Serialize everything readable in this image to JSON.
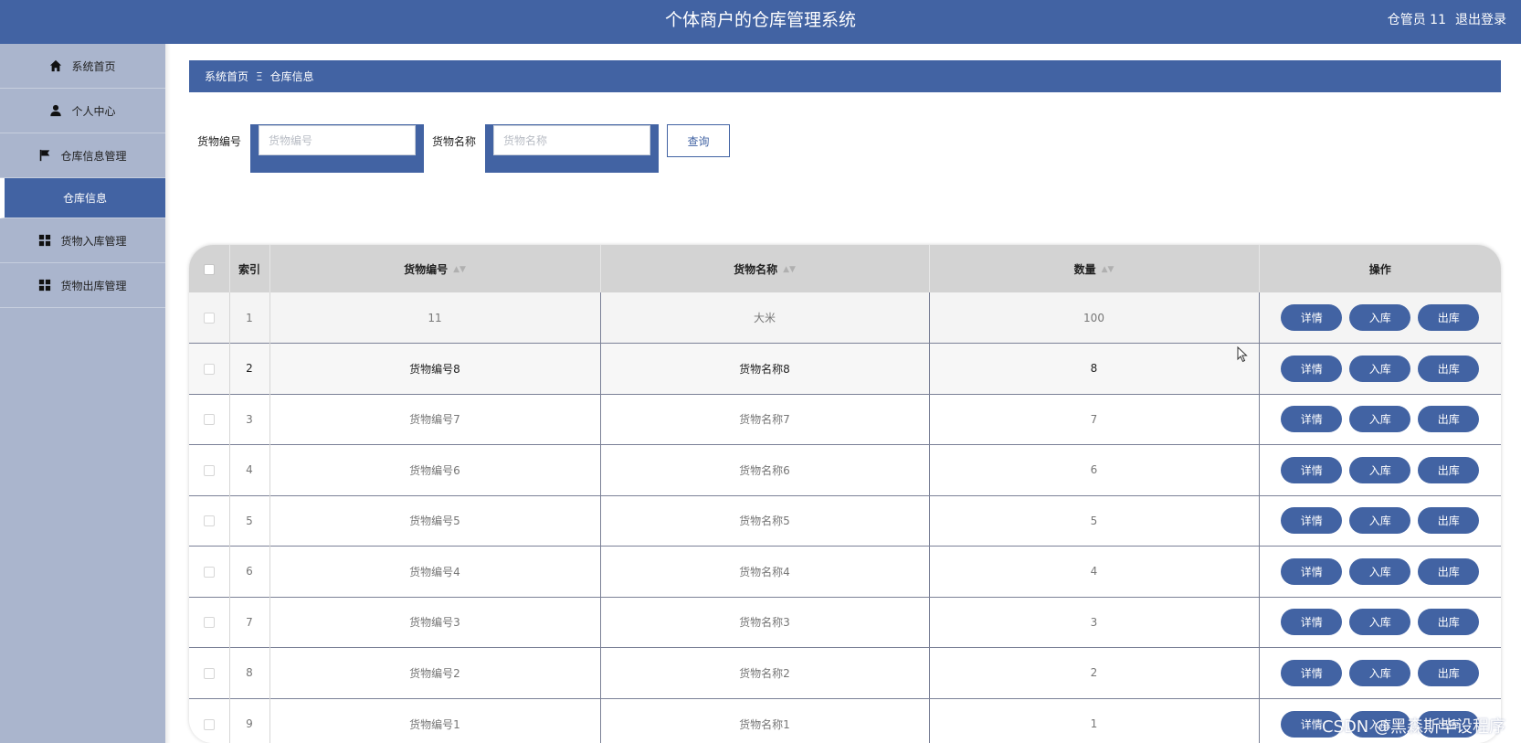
{
  "header": {
    "title": "个体商户的仓库管理系统",
    "user": "仓管员 11",
    "logout": "退出登录"
  },
  "sidebar": {
    "items": [
      {
        "label": "系统首页",
        "icon": "home-icon"
      },
      {
        "label": "个人中心",
        "icon": "user-icon"
      },
      {
        "label": "仓库信息管理",
        "icon": "flag-icon"
      },
      {
        "label": "仓库信息",
        "icon": "",
        "active": true
      },
      {
        "label": "货物入库管理",
        "icon": "grid-icon"
      },
      {
        "label": "货物出库管理",
        "icon": "grid-icon"
      }
    ]
  },
  "breadcrumb": {
    "home": "系统首页",
    "separator": "Ξ",
    "current": "仓库信息"
  },
  "search": {
    "code_label": "货物编号",
    "code_placeholder": "货物编号",
    "code_value": "",
    "name_label": "货物名称",
    "name_placeholder": "货物名称",
    "name_value": "",
    "query_button": "查询"
  },
  "table": {
    "columns": [
      "",
      "索引",
      "货物编号",
      "货物名称",
      "数量",
      "操作"
    ],
    "actions": [
      "详情",
      "入库",
      "出库"
    ],
    "rows": [
      {
        "index": "1",
        "code": "11",
        "name": "大米",
        "qty": "100"
      },
      {
        "index": "2",
        "code": "货物编号8",
        "name": "货物名称8",
        "qty": "8"
      },
      {
        "index": "3",
        "code": "货物编号7",
        "name": "货物名称7",
        "qty": "7"
      },
      {
        "index": "4",
        "code": "货物编号6",
        "name": "货物名称6",
        "qty": "6"
      },
      {
        "index": "5",
        "code": "货物编号5",
        "name": "货物名称5",
        "qty": "5"
      },
      {
        "index": "6",
        "code": "货物编号4",
        "name": "货物名称4",
        "qty": "4"
      },
      {
        "index": "7",
        "code": "货物编号3",
        "name": "货物名称3",
        "qty": "3"
      },
      {
        "index": "8",
        "code": "货物编号2",
        "name": "货物名称2",
        "qty": "2"
      },
      {
        "index": "9",
        "code": "货物编号1",
        "name": "货物名称1",
        "qty": "1"
      }
    ]
  },
  "watermark": "CSDN @黑森斯毕设程序",
  "colors": {
    "primary": "#4263a3",
    "sidebar": "#aab5cd",
    "table_header": "#d3d3d3"
  }
}
